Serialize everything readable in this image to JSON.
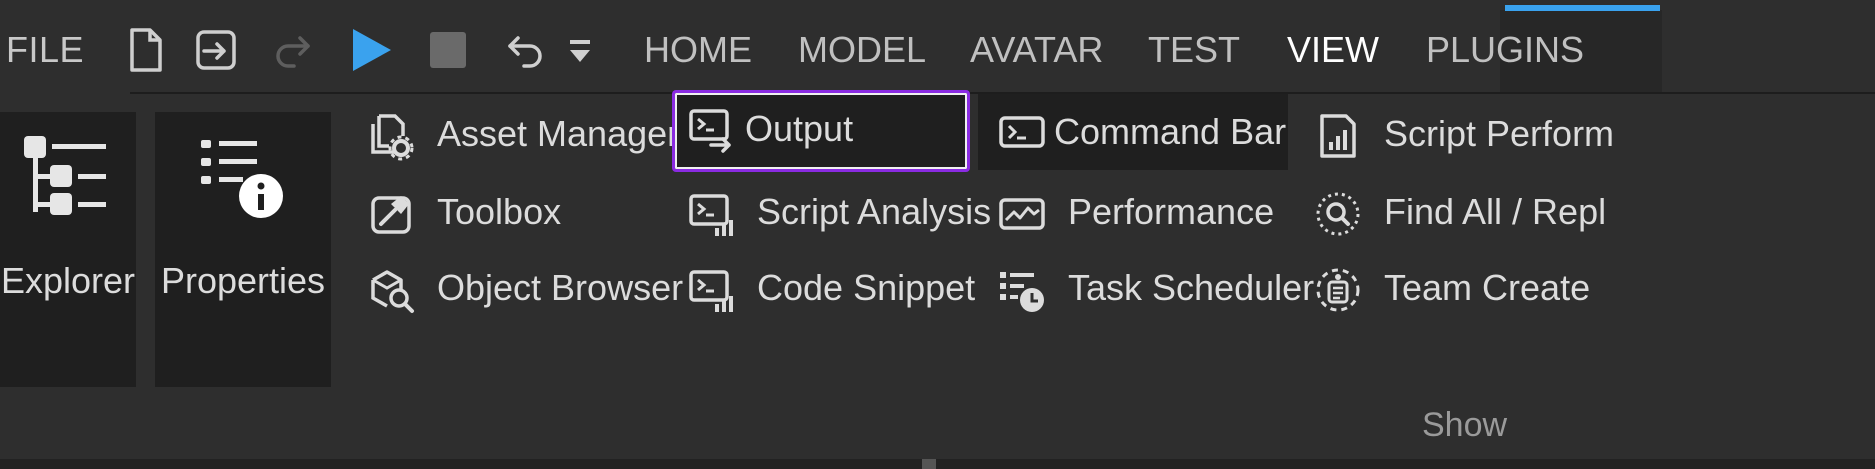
{
  "menu": {
    "file_label": "FILE"
  },
  "toolbar_icons": [
    "new-file-icon",
    "import-icon",
    "redo-icon",
    "play-icon",
    "stop-icon",
    "undo-icon",
    "customize-dropdown-icon"
  ],
  "tabs": [
    {
      "label": "HOME"
    },
    {
      "label": "MODEL"
    },
    {
      "label": "AVATAR"
    },
    {
      "label": "TEST"
    },
    {
      "label": "VIEW"
    },
    {
      "label": "PLUGINS"
    }
  ],
  "active_tab": "VIEW",
  "colors": {
    "accent": "#3aa2ee",
    "play": "#3aa2ee",
    "highlight_border": "#8a2be2",
    "background": "#2e2e2e",
    "button_bg": "#1f1f1f"
  },
  "ribbon": {
    "explorer_label": "Explorer",
    "properties_label": "Properties",
    "col1": [
      {
        "label": "Asset Manager",
        "icon": "asset-manager-icon"
      },
      {
        "label": "Toolbox",
        "icon": "toolbox-icon"
      },
      {
        "label": "Object Browser",
        "icon": "object-browser-icon"
      }
    ],
    "col2": [
      {
        "label": "Output",
        "icon": "output-icon"
      },
      {
        "label": "Script Analysis",
        "icon": "script-analysis-icon"
      },
      {
        "label": "Code Snippet",
        "icon": "code-snippet-icon"
      }
    ],
    "col3": [
      {
        "label": "Command Bar",
        "icon": "command-bar-icon"
      },
      {
        "label": "Performance",
        "icon": "performance-icon"
      },
      {
        "label": "Task Scheduler",
        "icon": "task-scheduler-icon"
      }
    ],
    "col4": [
      {
        "label": "Script Perform",
        "icon": "script-performance-icon"
      },
      {
        "label": "Find All / Repl",
        "icon": "find-all-icon"
      },
      {
        "label": "Team Create",
        "icon": "team-create-icon"
      }
    ],
    "group_label": "Show"
  }
}
